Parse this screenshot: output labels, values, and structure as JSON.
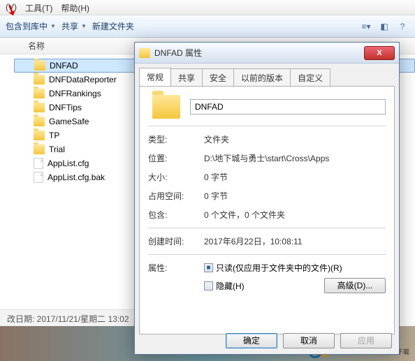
{
  "menubar": {
    "view": "(V)",
    "tools": "工具(T)",
    "help": "帮助(H)"
  },
  "toolbar": {
    "include": "包含到库中",
    "share": "共享",
    "newfolder": "新建文件夹"
  },
  "list": {
    "header": "名称",
    "items": [
      {
        "name": "DNFAD",
        "type": "folder",
        "selected": true
      },
      {
        "name": "DNFDataReporter",
        "type": "folder"
      },
      {
        "name": "DNFRankings",
        "type": "folder"
      },
      {
        "name": "DNFTips",
        "type": "folder"
      },
      {
        "name": "GameSafe",
        "type": "folder"
      },
      {
        "name": "TP",
        "type": "folder"
      },
      {
        "name": "Trial",
        "type": "folder"
      },
      {
        "name": "AppList.cfg",
        "type": "file"
      },
      {
        "name": "AppList.cfg.bak",
        "type": "file"
      }
    ]
  },
  "statusbar": "改日期: 2017/11/21/星期二 13:02",
  "watermark": {
    "brand": "uzzf",
    "dotcom": ".com",
    "cn": "东坡下载"
  },
  "dialog": {
    "title": "DNFAD 属性",
    "close": "X",
    "tabs": [
      "常规",
      "共享",
      "安全",
      "以前的版本",
      "自定义"
    ],
    "name_value": "DNFAD",
    "rows": {
      "type_l": "类型:",
      "type_v": "文件夹",
      "loc_l": "位置:",
      "loc_v": "D:\\地下城与勇士\\start\\Cross\\Apps",
      "size_l": "大小:",
      "size_v": "0 字节",
      "disk_l": "占用空间:",
      "disk_v": "0 字节",
      "contains_l": "包含:",
      "contains_v": "0 个文件，0 个文件夹",
      "created_l": "创建时间:",
      "created_v": "2017年6月22日，10:08:11",
      "attr_l": "属性:"
    },
    "attrs": {
      "readonly": "只读(仅应用于文件夹中的文件)(R)",
      "hidden": "隐藏(H)",
      "advanced": "高级(D)..."
    },
    "buttons": {
      "ok": "确定",
      "cancel": "取消",
      "apply": "应用"
    }
  }
}
